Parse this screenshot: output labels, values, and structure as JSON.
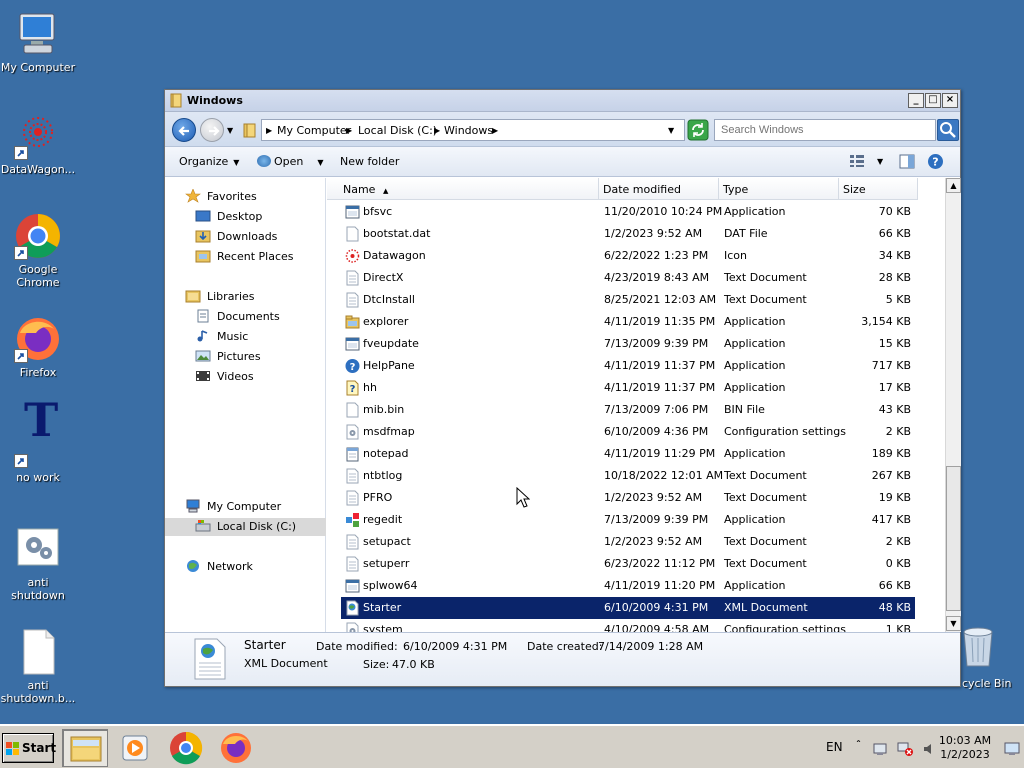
{
  "desktop": {
    "icons": [
      {
        "label": "My Computer",
        "icon": "my-computer-icon"
      },
      {
        "label": "DataWagon...",
        "icon": "datawagon-icon"
      },
      {
        "label": "Google Chrome",
        "icon": "chrome-icon"
      },
      {
        "label": "Firefox",
        "icon": "firefox-icon"
      },
      {
        "label": "no work",
        "icon": "no-work-icon",
        "glyph": "T"
      },
      {
        "label": "anti shutdown",
        "icon": "anti-shutdown-icon"
      },
      {
        "label": "anti shutdown.b...",
        "icon": "text-file-icon"
      }
    ],
    "recycle_label": "cycle Bin"
  },
  "window": {
    "title": "Windows",
    "buttons": {
      "minimize": "_",
      "maximize": "□",
      "close": "×"
    },
    "address": {
      "crumbs": [
        "My Computer",
        "Local Disk (C:)",
        "Windows"
      ]
    },
    "search_placeholder": "Search Windows",
    "toolbar": {
      "organize": "Organize",
      "open": "Open",
      "new_folder": "New folder"
    },
    "nav": {
      "favorites": "Favorites",
      "desktop": "Desktop",
      "downloads": "Downloads",
      "recent_places": "Recent Places",
      "libraries": "Libraries",
      "documents": "Documents",
      "music": "Music",
      "pictures": "Pictures",
      "videos": "Videos",
      "my_computer": "My Computer",
      "local_disk": "Local Disk (C:)",
      "network": "Network"
    },
    "columns": {
      "name": "Name",
      "date": "Date modified",
      "type": "Type",
      "size": "Size"
    },
    "files": [
      {
        "name": "bfsvc",
        "date": "11/20/2010 10:24 PM",
        "type": "Application",
        "size": "70 KB",
        "icon": "app"
      },
      {
        "name": "bootstat.dat",
        "date": "1/2/2023 9:52 AM",
        "type": "DAT File",
        "size": "66 KB",
        "icon": "file"
      },
      {
        "name": "Datawagon",
        "date": "6/22/2022 1:23 PM",
        "type": "Icon",
        "size": "34 KB",
        "icon": "datawagon"
      },
      {
        "name": "DirectX",
        "date": "4/23/2019 8:43 AM",
        "type": "Text Document",
        "size": "28 KB",
        "icon": "text"
      },
      {
        "name": "DtcInstall",
        "date": "8/25/2021 12:03 AM",
        "type": "Text Document",
        "size": "5 KB",
        "icon": "text"
      },
      {
        "name": "explorer",
        "date": "4/11/2019 11:35 PM",
        "type": "Application",
        "size": "3,154 KB",
        "icon": "folder"
      },
      {
        "name": "fveupdate",
        "date": "7/13/2009 9:39 PM",
        "type": "Application",
        "size": "15 KB",
        "icon": "app"
      },
      {
        "name": "HelpPane",
        "date": "4/11/2019 11:37 PM",
        "type": "Application",
        "size": "717 KB",
        "icon": "help"
      },
      {
        "name": "hh",
        "date": "4/11/2019 11:37 PM",
        "type": "Application",
        "size": "17 KB",
        "icon": "hh"
      },
      {
        "name": "mib.bin",
        "date": "7/13/2009 7:06 PM",
        "type": "BIN File",
        "size": "43 KB",
        "icon": "file"
      },
      {
        "name": "msdfmap",
        "date": "6/10/2009 4:36 PM",
        "type": "Configuration settings",
        "size": "2 KB",
        "icon": "config"
      },
      {
        "name": "notepad",
        "date": "4/11/2019 11:29 PM",
        "type": "Application",
        "size": "189 KB",
        "icon": "notepad"
      },
      {
        "name": "ntbtlog",
        "date": "10/18/2022 12:01 AM",
        "type": "Text Document",
        "size": "267 KB",
        "icon": "text"
      },
      {
        "name": "PFRO",
        "date": "1/2/2023 9:52 AM",
        "type": "Text Document",
        "size": "19 KB",
        "icon": "text"
      },
      {
        "name": "regedit",
        "date": "7/13/2009 9:39 PM",
        "type": "Application",
        "size": "417 KB",
        "icon": "regedit"
      },
      {
        "name": "setupact",
        "date": "1/2/2023 9:52 AM",
        "type": "Text Document",
        "size": "2 KB",
        "icon": "text"
      },
      {
        "name": "setuperr",
        "date": "6/23/2022 11:12 PM",
        "type": "Text Document",
        "size": "0 KB",
        "icon": "text"
      },
      {
        "name": "splwow64",
        "date": "4/11/2019 11:20 PM",
        "type": "Application",
        "size": "66 KB",
        "icon": "app"
      },
      {
        "name": "Starter",
        "date": "6/10/2009 4:31 PM",
        "type": "XML Document",
        "size": "48 KB",
        "icon": "xml",
        "selected": true
      },
      {
        "name": "system",
        "date": "4/10/2009 4:58 AM",
        "type": "Configuration settings",
        "size": "1 KB",
        "icon": "config"
      }
    ],
    "details": {
      "name": "Starter",
      "type": "XML Document",
      "modified_label": "Date modified:",
      "modified_value": "6/10/2009 4:31 PM",
      "created_label": "Date created:",
      "created_value": "7/14/2009 1:28 AM",
      "size_label": "Size:",
      "size_value": "47.0 KB"
    }
  },
  "taskbar": {
    "start": "Start",
    "lang": "EN",
    "time": "10:03 AM",
    "date": "1/2/2023"
  },
  "colors": {
    "desktop": "#3a6ea5",
    "selection": "#0a246a",
    "taskbar": "#d4d0c8"
  }
}
